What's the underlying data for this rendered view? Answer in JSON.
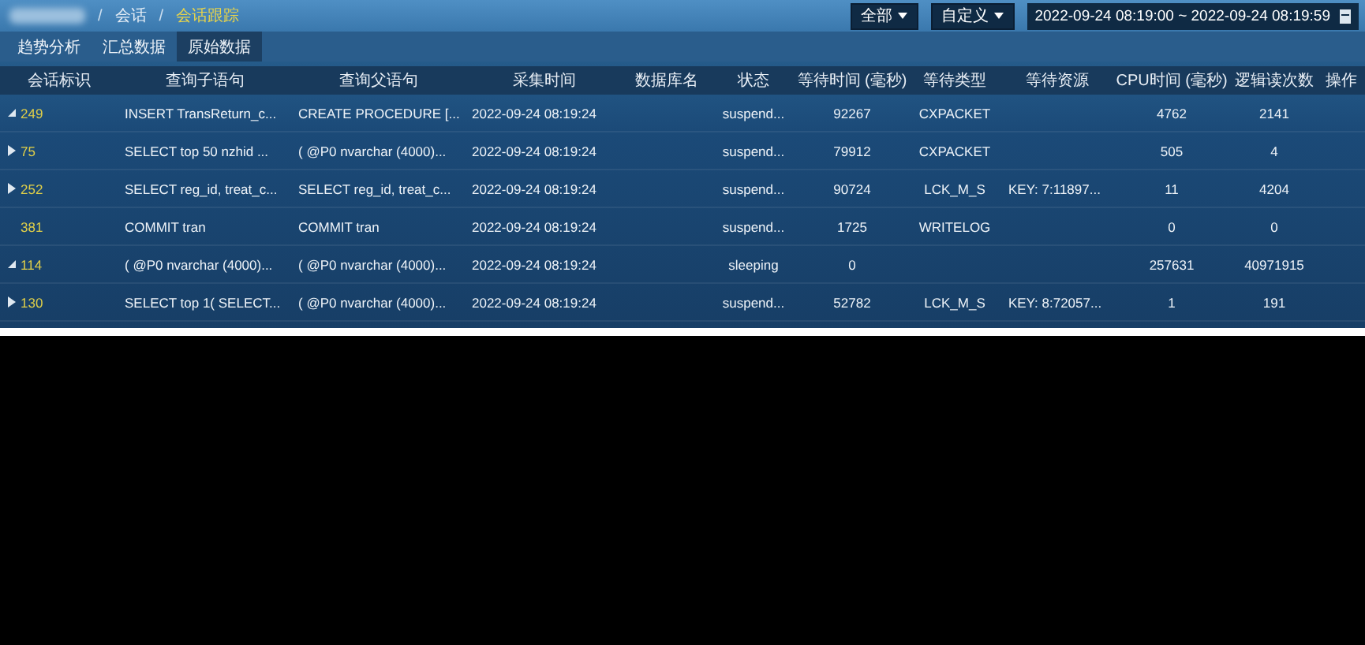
{
  "breadcrumb": {
    "separator": "/",
    "items": [
      {
        "label": "会话",
        "current": false
      },
      {
        "label": "会话跟踪",
        "current": true
      }
    ]
  },
  "filters": {
    "scope": "全部",
    "range_mode": "自定义",
    "date_range": "2022-09-24 08:19:00 ~ 2022-09-24 08:19:59"
  },
  "tabs": [
    {
      "label": "趋势分析",
      "selected": false
    },
    {
      "label": "汇总数据",
      "selected": false
    },
    {
      "label": "原始数据",
      "selected": true
    }
  ],
  "table": {
    "columns": [
      "会话标识",
      "查询子语句",
      "查询父语句",
      "采集时间",
      "数据库名",
      "状态",
      "等待时间 (毫秒)",
      "等待类型",
      "等待资源",
      "CPU时间 (毫秒)",
      "逻辑读次数",
      "操作"
    ],
    "rows": [
      {
        "expandable": true,
        "expanded": true,
        "cells": [
          "249",
          "INSERT TransReturn_c...",
          "CREATE PROCEDURE [...",
          "2022-09-24 08:19:24",
          "",
          "suspend...",
          "92267",
          "CXPACKET",
          "",
          "4762",
          "2141",
          ""
        ]
      },
      {
        "expandable": true,
        "expanded": false,
        "cells": [
          "75",
          "SELECT top 50 nzhid ...",
          "( @P0 nvarchar (4000)...",
          "2022-09-24 08:19:24",
          "",
          "suspend...",
          "79912",
          "CXPACKET",
          "",
          "505",
          "4",
          ""
        ]
      },
      {
        "expandable": true,
        "expanded": false,
        "cells": [
          "252",
          "SELECT reg_id, treat_c...",
          "SELECT reg_id, treat_c...",
          "2022-09-24 08:19:24",
          "",
          "suspend...",
          "90724",
          "LCK_M_S",
          "KEY: 7:11897...",
          "11",
          "4204",
          ""
        ]
      },
      {
        "expandable": false,
        "cells": [
          "381",
          "COMMIT tran",
          "COMMIT tran",
          "2022-09-24 08:19:24",
          "",
          "suspend...",
          "1725",
          "WRITELOG",
          "",
          "0",
          "0",
          ""
        ]
      },
      {
        "expandable": true,
        "expanded": true,
        "cells": [
          "114",
          "( @P0 nvarchar (4000)...",
          "( @P0 nvarchar (4000)...",
          "2022-09-24 08:19:24",
          "",
          "sleeping",
          "0",
          "",
          "",
          "257631",
          "40971915",
          ""
        ]
      },
      {
        "expandable": true,
        "expanded": false,
        "cells": [
          "130",
          "SELECT top 1( SELECT...",
          "( @P0 nvarchar (4000)...",
          "2022-09-24 08:19:24",
          "",
          "suspend...",
          "52782",
          "LCK_M_S",
          "KEY: 8:72057...",
          "1",
          "191",
          ""
        ]
      }
    ]
  }
}
